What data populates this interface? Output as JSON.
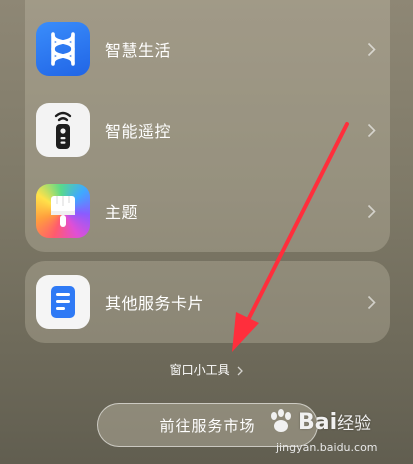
{
  "services": [
    {
      "label": "智慧生活",
      "icon": "smart-life-icon"
    },
    {
      "label": "智能遥控",
      "icon": "remote-control-icon"
    },
    {
      "label": "主题",
      "icon": "theme-brush-icon"
    }
  ],
  "other_card": {
    "label": "其他服务卡片",
    "icon": "service-card-icon"
  },
  "widget_link": {
    "label": "窗口小工具"
  },
  "market_button": {
    "label": "前往服务市场"
  },
  "watermark": {
    "logo": "Bai",
    "logo_suffix": "经验",
    "url": "jingyan.baidu.com"
  },
  "colors": {
    "annotation_arrow": "#ff2e3c",
    "smart_life_blue": "#2f7af5"
  }
}
